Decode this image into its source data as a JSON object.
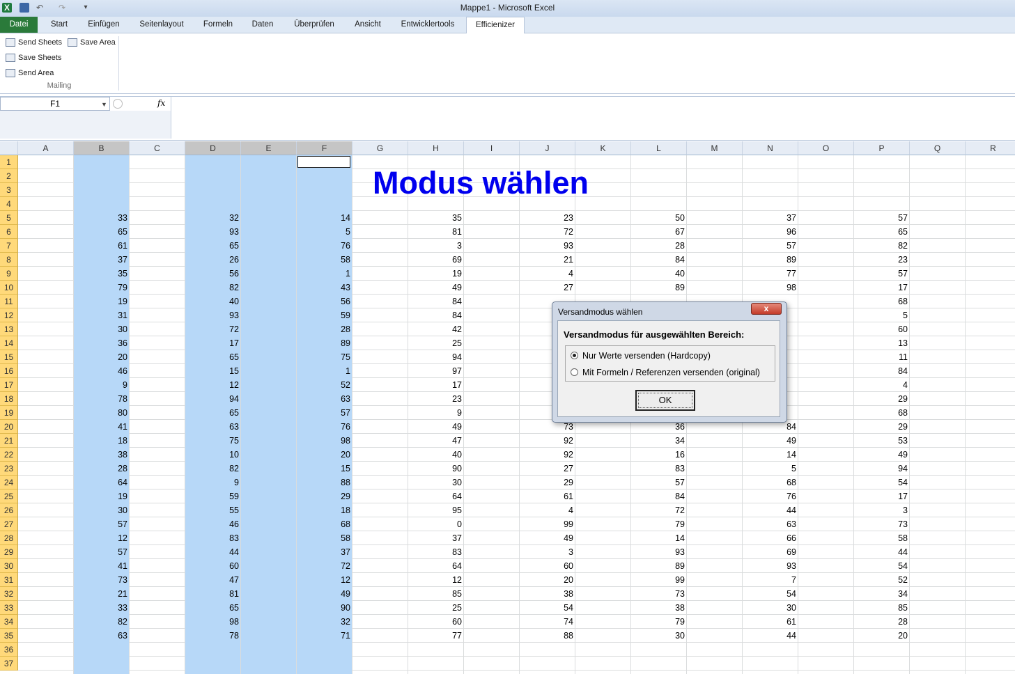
{
  "window": {
    "title": "Mappe1  -  Microsoft Excel"
  },
  "quick_access": {
    "logo_glyph": "X",
    "undo_glyph": "↶",
    "redo_glyph": "↷",
    "customize_glyph": "▾"
  },
  "tabs": [
    "Datei",
    "Start",
    "Einfügen",
    "Seitenlayout",
    "Formeln",
    "Daten",
    "Überprüfen",
    "Ansicht",
    "Entwicklertools",
    "Efficienizer"
  ],
  "ribbon": {
    "buttons": {
      "send_sheets": "Send Sheets",
      "save_area": "Save Area",
      "save_sheets": "Save Sheets",
      "send_area": "Send Area"
    },
    "group_label": "Mailing"
  },
  "formula_bar": {
    "name_box": "F1",
    "fx_label": "fx",
    "formula": ""
  },
  "columns": [
    "A",
    "B",
    "C",
    "D",
    "E",
    "F",
    "G",
    "H",
    "I",
    "J",
    "K",
    "L",
    "M",
    "N",
    "O",
    "P",
    "Q",
    "R"
  ],
  "selected_columns": [
    "B",
    "D",
    "E",
    "F"
  ],
  "rows": [
    1,
    2,
    3,
    4,
    5,
    6,
    7,
    8,
    9,
    10,
    11,
    12,
    13,
    14,
    15,
    16,
    17,
    18,
    19,
    20,
    21,
    22,
    23,
    24,
    25,
    26,
    27,
    28,
    29,
    30,
    31,
    32,
    33,
    34,
    35,
    36,
    37
  ],
  "sheet": {
    "title": "Modus wählen",
    "title_color": "#0000ee",
    "data_start_row": 5,
    "data_columns": [
      "B",
      "D",
      "F",
      "H",
      "J",
      "L",
      "N",
      "P"
    ],
    "data": [
      [
        33,
        32,
        14,
        35,
        23,
        50,
        37,
        57
      ],
      [
        65,
        93,
        5,
        81,
        72,
        67,
        96,
        65
      ],
      [
        61,
        65,
        76,
        3,
        93,
        28,
        57,
        82
      ],
      [
        37,
        26,
        58,
        69,
        21,
        84,
        89,
        23
      ],
      [
        35,
        56,
        1,
        19,
        4,
        40,
        77,
        57
      ],
      [
        79,
        82,
        43,
        49,
        27,
        89,
        98,
        17
      ],
      [
        19,
        40,
        56,
        84,
        "",
        "",
        "",
        68
      ],
      [
        31,
        93,
        59,
        84,
        "",
        "",
        "",
        5
      ],
      [
        30,
        72,
        28,
        42,
        "",
        "",
        "",
        60
      ],
      [
        36,
        17,
        89,
        25,
        "",
        "",
        "",
        13
      ],
      [
        20,
        65,
        75,
        94,
        "",
        "",
        "",
        11
      ],
      [
        46,
        15,
        1,
        97,
        "",
        "",
        "",
        84
      ],
      [
        9,
        12,
        52,
        17,
        "",
        "",
        "",
        4
      ],
      [
        78,
        94,
        63,
        23,
        "",
        "",
        "",
        29
      ],
      [
        80,
        65,
        57,
        9,
        "",
        "",
        "",
        68
      ],
      [
        41,
        63,
        76,
        49,
        73,
        36,
        84,
        29
      ],
      [
        18,
        75,
        98,
        47,
        92,
        34,
        49,
        53
      ],
      [
        38,
        10,
        20,
        40,
        92,
        16,
        14,
        49
      ],
      [
        28,
        82,
        15,
        90,
        27,
        83,
        5,
        94
      ],
      [
        64,
        9,
        88,
        30,
        29,
        57,
        68,
        54
      ],
      [
        19,
        59,
        29,
        64,
        61,
        84,
        76,
        17
      ],
      [
        30,
        55,
        18,
        95,
        4,
        72,
        44,
        3
      ],
      [
        57,
        46,
        68,
        0,
        99,
        79,
        63,
        73
      ],
      [
        12,
        83,
        58,
        37,
        49,
        14,
        66,
        58
      ],
      [
        57,
        44,
        37,
        83,
        3,
        93,
        69,
        44
      ],
      [
        41,
        60,
        72,
        64,
        60,
        89,
        93,
        54
      ],
      [
        73,
        47,
        12,
        12,
        20,
        99,
        7,
        52
      ],
      [
        21,
        81,
        49,
        85,
        38,
        73,
        54,
        34
      ],
      [
        33,
        65,
        90,
        25,
        54,
        38,
        30,
        85
      ],
      [
        82,
        98,
        32,
        60,
        74,
        79,
        61,
        28
      ],
      [
        63,
        78,
        71,
        77,
        88,
        30,
        44,
        20
      ]
    ]
  },
  "dialog": {
    "title": "Versandmodus wählen",
    "close_label": "x",
    "question": "Versandmodus für ausgewählten Bereich:",
    "options": [
      {
        "label": "Nur Werte versenden (Hardcopy)",
        "selected": true
      },
      {
        "label": "Mit Formeln / Referenzen versenden (original)",
        "selected": false
      }
    ],
    "ok_label": "OK"
  },
  "colors": {
    "selection": "#b7d8f8",
    "row_header": "#ffd97a",
    "datei_tab": "#2a7a3a"
  }
}
